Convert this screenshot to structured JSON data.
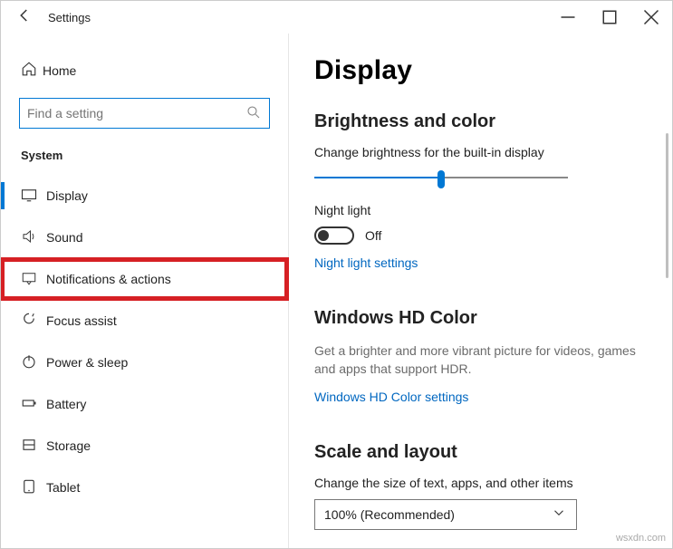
{
  "titlebar": {
    "title": "Settings"
  },
  "sidebar": {
    "home": "Home",
    "search_placeholder": "Find a setting",
    "section": "System",
    "items": [
      {
        "label": "Display"
      },
      {
        "label": "Sound"
      },
      {
        "label": "Notifications & actions"
      },
      {
        "label": "Focus assist"
      },
      {
        "label": "Power & sleep"
      },
      {
        "label": "Battery"
      },
      {
        "label": "Storage"
      },
      {
        "label": "Tablet"
      }
    ]
  },
  "main": {
    "heading": "Display",
    "brightness": {
      "title": "Brightness and color",
      "desc": "Change brightness for the built-in display",
      "night_label": "Night light",
      "night_state": "Off",
      "night_link": "Night light settings"
    },
    "hd": {
      "title": "Windows HD Color",
      "desc": "Get a brighter and more vibrant picture for videos, games and apps that support HDR.",
      "link": "Windows HD Color settings"
    },
    "scale": {
      "title": "Scale and layout",
      "desc": "Change the size of text, apps, and other items",
      "value": "100% (Recommended)"
    }
  },
  "watermark": "wsxdn.com"
}
